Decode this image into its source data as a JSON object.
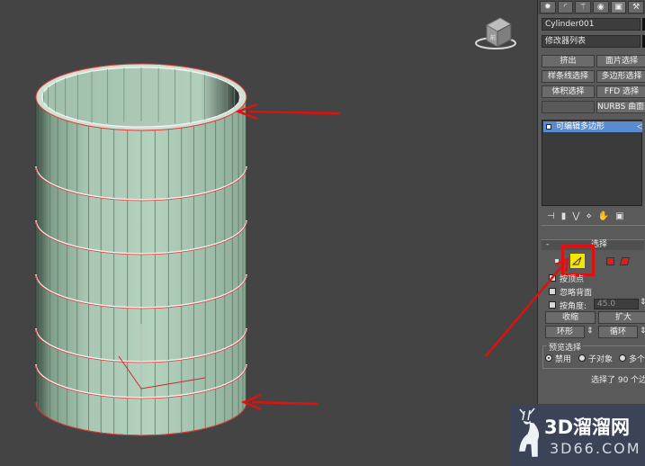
{
  "panel": {
    "tabs": [
      "✹",
      "◜",
      "⚚",
      "◉",
      "▣",
      "⚒"
    ],
    "object_name": "Cylinder001",
    "modifier_list": "修改器列表",
    "buttons": [
      [
        "挤出",
        "面片选择"
      ],
      [
        "样条线选择",
        "多边形选择"
      ],
      [
        "体积选择",
        "FFD 选择"
      ],
      [
        "",
        "NURBS 曲面选"
      ]
    ],
    "stack_item": "可编辑多边形",
    "stack_arrow": "◁",
    "toolbar_icons": [
      "⊣",
      "▮",
      "⋁",
      "⋄",
      "✋",
      "▣"
    ]
  },
  "selection": {
    "header_pm": "-",
    "title": "选择",
    "by_vertex": "按顶点",
    "ignore_backfacing": "忽略背面",
    "angle_label": "按角度:",
    "angle_value": "45.0",
    "shrink": "收缩",
    "grow": "扩大",
    "ring": "环形",
    "loop": "循环",
    "preview_label": "预览选择",
    "preview_off": "禁用",
    "preview_sub": "子对象",
    "preview_multi": "多个",
    "status": "选择了 90 个边"
  },
  "viewcube": {
    "label": "前"
  },
  "watermark": {
    "line1": "3D溜溜网",
    "line2": "3D66.COM"
  },
  "colors": {
    "viewport_bg": "#444444",
    "cylinder_fill": "#a6c4b0",
    "selected_edge": "#e23a3a",
    "annotation_arrow": "#e01010",
    "edge_mode_button": "#f5e600"
  }
}
